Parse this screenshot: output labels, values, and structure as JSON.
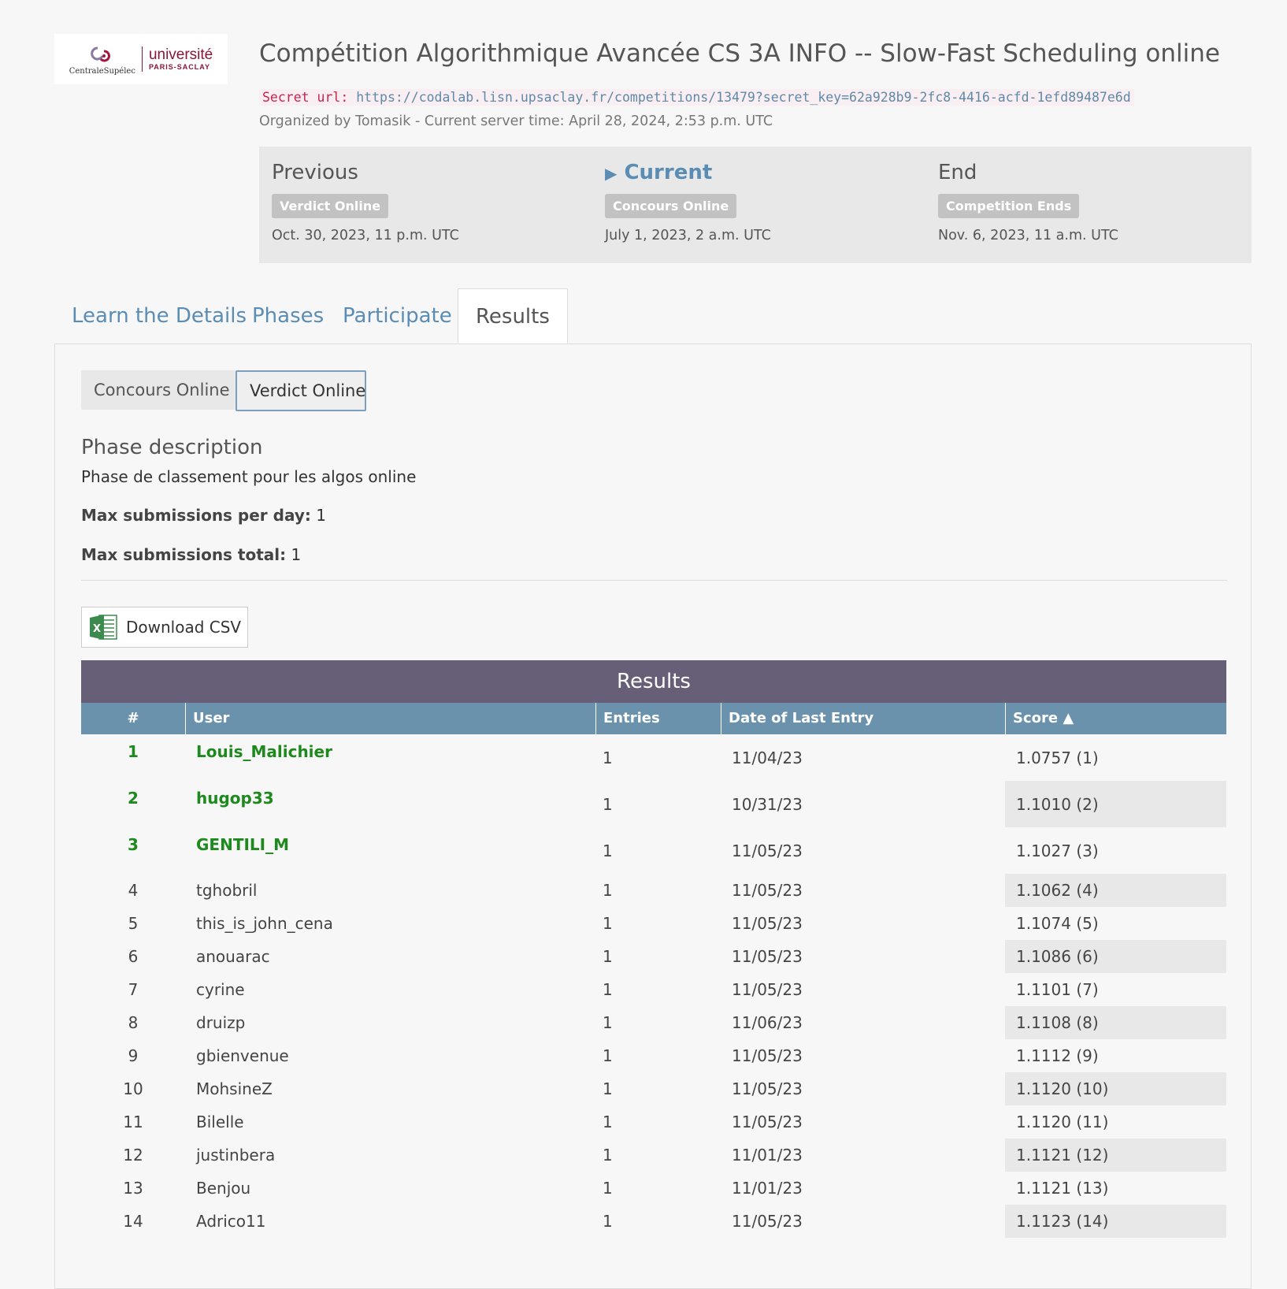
{
  "logo": {
    "left_text": "CentraleSupélec",
    "right_text_top": "université",
    "right_text_bottom": "PARIS-SACLAY"
  },
  "header": {
    "title": "Compétition Algorithmique Avancée CS 3A INFO -- Slow-Fast Scheduling online",
    "secret_label": "Secret url:",
    "secret_url": "https://codalab.lisn.upsaclay.fr/competitions/13479?secret_key=62a928b9-2fc8-4416-acfd-1efd89487e6d",
    "organized": "Organized by Tomasik - Current server time: April 28, 2024, 2:53 p.m. UTC"
  },
  "phases": {
    "previous": {
      "heading": "Previous",
      "badge": "Verdict Online",
      "date": "Oct. 30, 2023, 11 p.m. UTC"
    },
    "current": {
      "heading": "Current",
      "badge": "Concours Online",
      "date": "July 1, 2023, 2 a.m. UTC"
    },
    "end": {
      "heading": "End",
      "badge": "Competition Ends",
      "date": "Nov. 6, 2023, 11 a.m. UTC"
    }
  },
  "tabs": {
    "learn": "Learn the Details",
    "phases": "Phases",
    "participate": "Participate",
    "results": "Results"
  },
  "subtabs": {
    "concours": "Concours Online",
    "verdict": "Verdict Online"
  },
  "phase_description": {
    "title": "Phase description",
    "text": "Phase de classement pour les algos online",
    "max_day_label": "Max submissions per day:",
    "max_day_value": "1",
    "max_total_label": "Max submissions total:",
    "max_total_value": "1"
  },
  "download_csv": "Download CSV",
  "results_table": {
    "caption": "Results",
    "columns": [
      "#",
      "User",
      "Entries",
      "Date of Last Entry",
      "Score"
    ],
    "rows": [
      {
        "rank": "1",
        "user": "Louis_Malichier",
        "entries": "1",
        "date": "11/04/23",
        "score": "1.0757 (1)"
      },
      {
        "rank": "2",
        "user": "hugop33",
        "entries": "1",
        "date": "10/31/23",
        "score": "1.1010 (2)"
      },
      {
        "rank": "3",
        "user": "GENTILI_M",
        "entries": "1",
        "date": "11/05/23",
        "score": "1.1027 (3)"
      },
      {
        "rank": "4",
        "user": "tghobril",
        "entries": "1",
        "date": "11/05/23",
        "score": "1.1062 (4)"
      },
      {
        "rank": "5",
        "user": "this_is_john_cena",
        "entries": "1",
        "date": "11/05/23",
        "score": "1.1074 (5)"
      },
      {
        "rank": "6",
        "user": "anouarac",
        "entries": "1",
        "date": "11/05/23",
        "score": "1.1086 (6)"
      },
      {
        "rank": "7",
        "user": "cyrine",
        "entries": "1",
        "date": "11/05/23",
        "score": "1.1101 (7)"
      },
      {
        "rank": "8",
        "user": "druizp",
        "entries": "1",
        "date": "11/06/23",
        "score": "1.1108 (8)"
      },
      {
        "rank": "9",
        "user": "gbienvenue",
        "entries": "1",
        "date": "11/05/23",
        "score": "1.1112 (9)"
      },
      {
        "rank": "10",
        "user": "MohsineZ",
        "entries": "1",
        "date": "11/05/23",
        "score": "1.1120 (10)"
      },
      {
        "rank": "11",
        "user": "Bilelle",
        "entries": "1",
        "date": "11/05/23",
        "score": "1.1120 (11)"
      },
      {
        "rank": "12",
        "user": "justinbera",
        "entries": "1",
        "date": "11/01/23",
        "score": "1.1121 (12)"
      },
      {
        "rank": "13",
        "user": "Benjou",
        "entries": "1",
        "date": "11/01/23",
        "score": "1.1121 (13)"
      },
      {
        "rank": "14",
        "user": "Adrico11",
        "entries": "1",
        "date": "11/05/23",
        "score": "1.1123 (14)"
      }
    ]
  },
  "colors": {
    "link_blue": "#5b8db4",
    "table_caption_bg": "#675f78",
    "table_header_bg": "#6b92ad",
    "winner_green": "#1e8a1e",
    "brand_red": "#8a1538"
  }
}
